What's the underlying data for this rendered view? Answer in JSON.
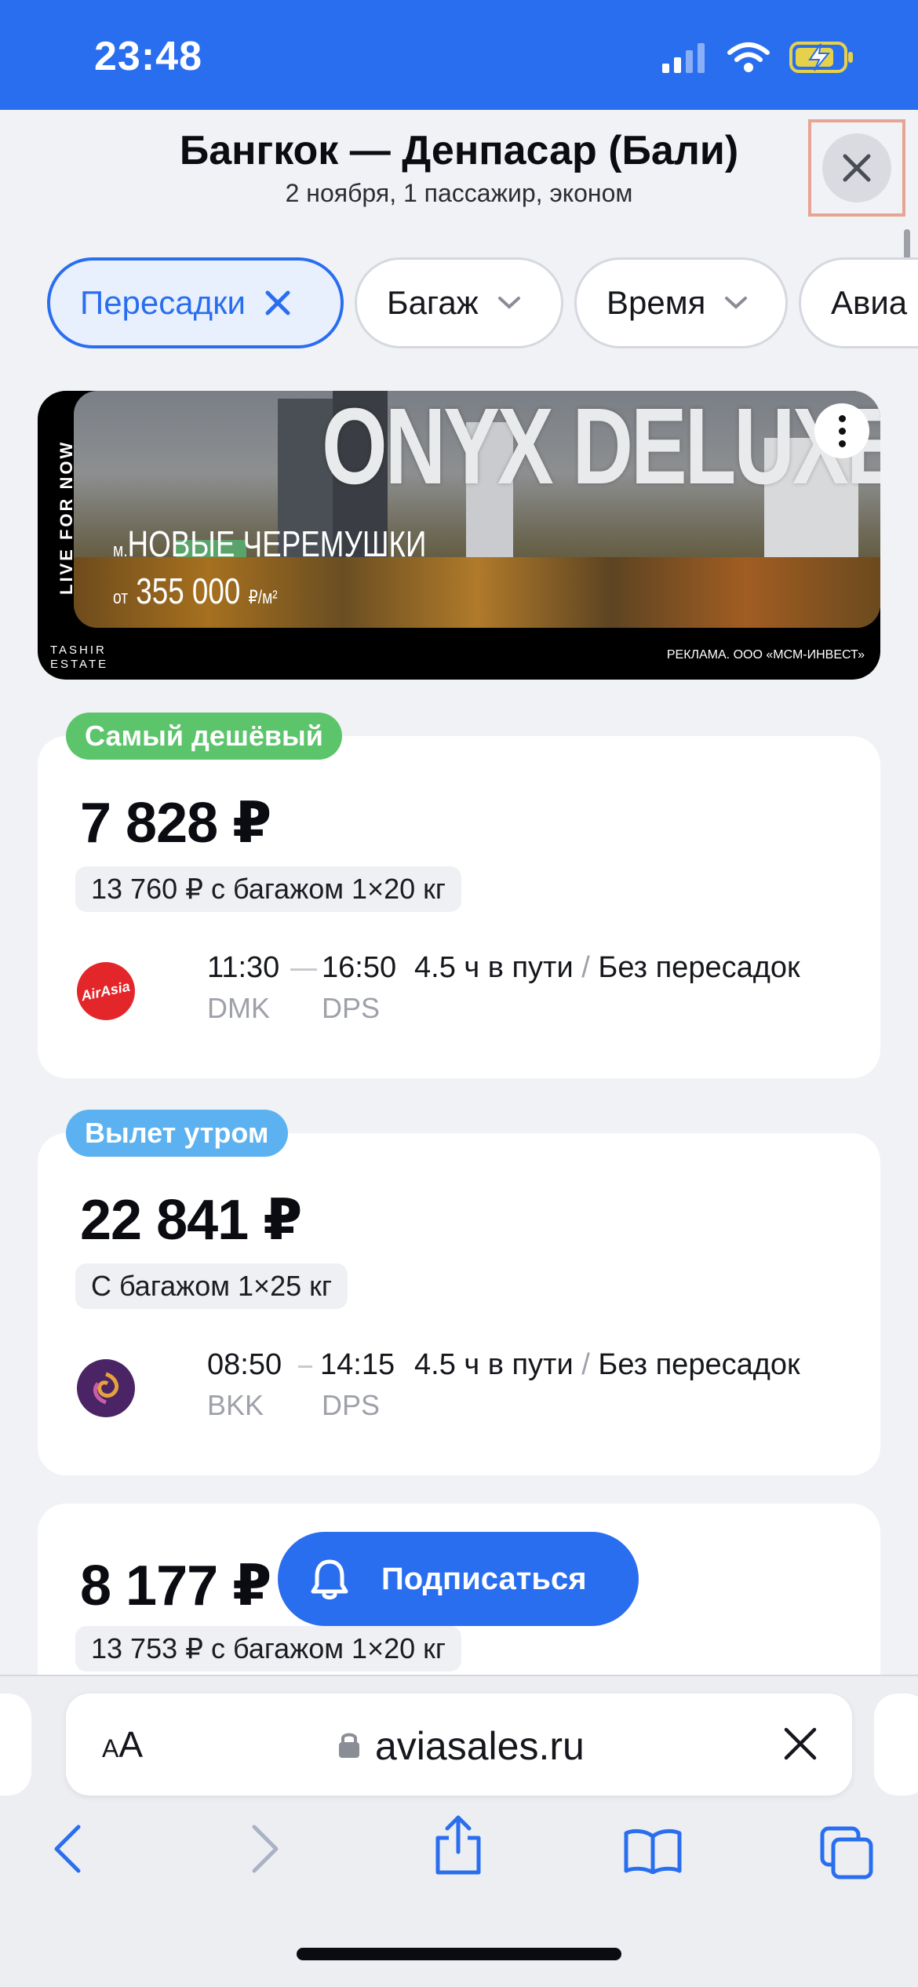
{
  "status_bar": {
    "time": "23:48"
  },
  "header": {
    "title": "Бангкок — Денпасар (Бали)",
    "subtitle": "2 ноября, 1 пассажир, эконом"
  },
  "filters": [
    {
      "label": "Пересадки",
      "active": true
    },
    {
      "label": "Багаж",
      "active": false
    },
    {
      "label": "Время",
      "active": false
    },
    {
      "label": "Авиа",
      "active": false
    }
  ],
  "ad": {
    "headline": "ONYX DELUXE",
    "metro_prefix": "м.",
    "metro": "НОВЫЕ ЧЕРЕМУШКИ",
    "price_prefix": "от",
    "price": "355 000",
    "price_unit": "₽/м²",
    "vertical_text": "LIVE FOR NOW",
    "brand_line1": "TASHIR",
    "brand_line2": "ESTATE",
    "disclaimer": "РЕКЛАМА. ООО «МСМ-ИНВЕСТ»"
  },
  "tickets": [
    {
      "badge": "Самый дешёвый",
      "badge_color": "#5cc46b",
      "price": "7 828 ₽",
      "baggage": "13 760 ₽ с багажом 1×20 кг",
      "airline_icon": "airasia-logo",
      "dep_time": "11:30",
      "arr_time": "16:50",
      "dep_code": "DMK",
      "arr_code": "DPS",
      "duration": "4.5 ч в пути",
      "stops": "Без пересадок"
    },
    {
      "badge": "Вылет утром",
      "badge_color": "#5cb2f0",
      "price": "22 841 ₽",
      "baggage": "С багажом 1×25 кг",
      "airline_icon": "thai-airways-logo",
      "dep_time": "08:50",
      "arr_time": "14:15",
      "dep_code": "BKK",
      "arr_code": "DPS",
      "duration": "4.5 ч в пути",
      "stops": "Без пересадок"
    },
    {
      "price": "8 177 ₽",
      "baggage": "13 753 ₽ с багажом 1×20 кг"
    }
  ],
  "subscribe": {
    "label": "Подписаться",
    "icon": "bell-icon"
  },
  "browser": {
    "aa_label_small": "A",
    "aa_label_big": "A",
    "url": "aviasales.ru"
  },
  "colors": {
    "accent": "#2a6ef0",
    "background": "#f1f2f6"
  }
}
